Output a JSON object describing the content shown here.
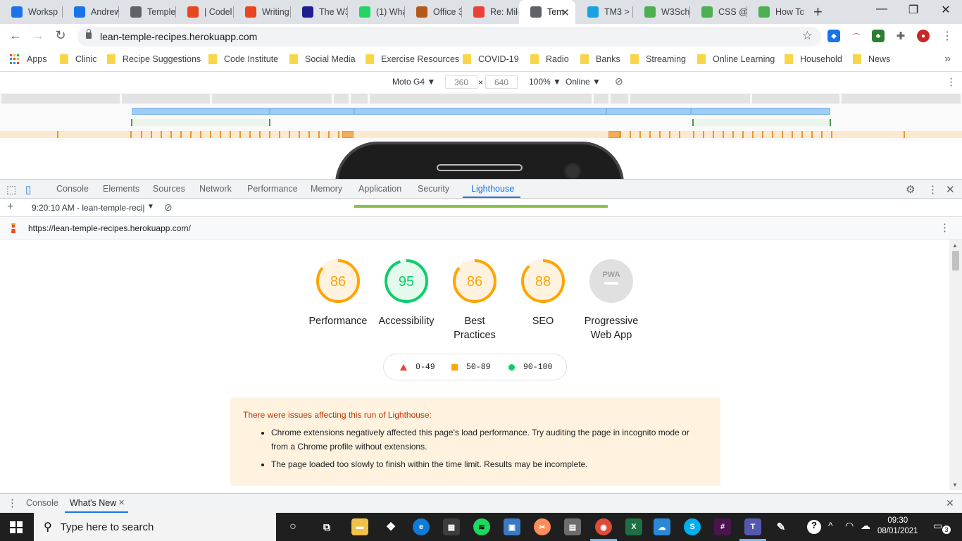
{
  "browser": {
    "tabs": [
      {
        "title": "Worksp",
        "icon": "hexagon-blue-icon",
        "color": "#1a73e8"
      },
      {
        "title": "Andrew",
        "icon": "hexagon-blue-icon",
        "color": "#1a73e8"
      },
      {
        "title": "Temple",
        "icon": "globe-icon",
        "color": "#5f6368"
      },
      {
        "title": "| Codel",
        "icon": "ring-red-icon",
        "color": "#e8461f"
      },
      {
        "title": "Writing",
        "icon": "ring-red-icon",
        "color": "#e8461f"
      },
      {
        "title": "The W3",
        "icon": "w3-icon",
        "color": "#1e1e8f"
      },
      {
        "title": "(1) Wha",
        "icon": "whatsapp-icon",
        "color": "#25d366"
      },
      {
        "title": "Office 3",
        "icon": "office-icon",
        "color": "#b35a1b"
      },
      {
        "title": "Re: Mile",
        "icon": "gmail-icon",
        "color": "#ea4335"
      },
      {
        "title": "Tem",
        "icon": "globe-icon",
        "color": "#5f6368",
        "active": true
      },
      {
        "title": "TM3 >",
        "icon": "tm3-icon",
        "color": "#1ba1e2"
      },
      {
        "title": "W3Scho",
        "icon": "w3schools-icon",
        "color": "#4caf50"
      },
      {
        "title": "CSS @n",
        "icon": "w3schools-icon",
        "color": "#4caf50"
      },
      {
        "title": "How To",
        "icon": "w3schools-icon",
        "color": "#4caf50"
      }
    ],
    "new_tab": "+",
    "window_controls": {
      "minimize": "—",
      "maximize": "❐",
      "close": "✕"
    },
    "url": "lean-temple-recipes.herokuapp.com",
    "bookmarks": [
      "Apps",
      "Clinic",
      "Recipe Suggestions",
      "Code Institute",
      "Social Media",
      "Exercise Resources",
      "COVID-19",
      "Radio",
      "Banks",
      "Streaming",
      "Online Learning",
      "Household",
      "News"
    ],
    "bookmarks_more": "»"
  },
  "device_toolbar": {
    "device": "Moto G4 ▼",
    "width": "360",
    "times": "×",
    "height": "640",
    "zoom": "100% ▼",
    "network": "Online ▼"
  },
  "devtools": {
    "tabs": [
      "Console",
      "Elements",
      "Sources",
      "Network",
      "Performance",
      "Memory",
      "Application",
      "Security",
      "Lighthouse"
    ],
    "active_tab": "Lighthouse",
    "report_selector": "9:20:10 AM - lean-temple-reci|",
    "report_url": "https://lean-temple-recipes.herokuapp.com/",
    "drawer_tabs": [
      "Console",
      "What's New"
    ],
    "drawer_active": "What's New"
  },
  "lighthouse": {
    "scores": [
      {
        "label": "Performance",
        "value": 86,
        "color": "#ffa400",
        "bg": "#fff3e0",
        "fraction": 0.86
      },
      {
        "label": "Accessibility",
        "value": 95,
        "color": "#0cce6b",
        "bg": "#e5faef",
        "fraction": 0.95
      },
      {
        "label": "Best Practices",
        "value": 86,
        "color": "#ffa400",
        "bg": "#fff3e0",
        "fraction": 0.86
      },
      {
        "label": "SEO",
        "value": 88,
        "color": "#ffa400",
        "bg": "#fff3e0",
        "fraction": 0.88
      },
      {
        "label": "Progressive Web App",
        "value": "PWA",
        "color": "#bdbdbd",
        "bg": "#e0e0e0",
        "fraction": 0
      }
    ],
    "legend": [
      {
        "range": "0-49",
        "shape": "triangle",
        "color": "#eb4335"
      },
      {
        "range": "50-89",
        "shape": "square",
        "color": "#ffa400"
      },
      {
        "range": "90-100",
        "shape": "circle",
        "color": "#0cce6b"
      }
    ],
    "warning_title": "There were issues affecting this run of Lighthouse:",
    "warnings": [
      "Chrome extensions negatively affected this page's load performance. Try auditing the page in incognito mode or from a Chrome profile without extensions.",
      "The page loaded too slowly to finish within the time limit. Results may be incomplete."
    ]
  },
  "taskbar": {
    "search_placeholder": "Type here to search",
    "time": "09:30",
    "date": "08/01/2021",
    "notifications": "3"
  }
}
